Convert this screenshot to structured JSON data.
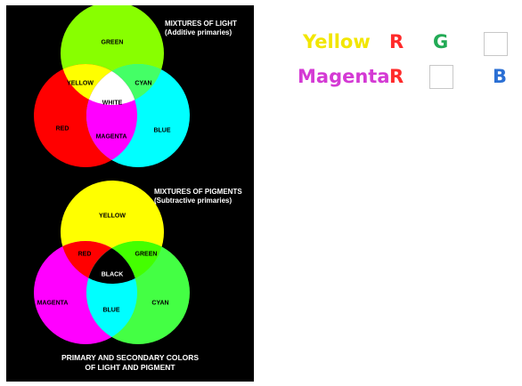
{
  "figure": {
    "light_title": "MIXTURES OF LIGHT",
    "light_subtitle": "(Additive primaries)",
    "pigment_title": "MIXTURES OF PIGMENTS",
    "pigment_subtitle": "(Subtractive primaries)",
    "caption_line1": "PRIMARY AND SECONDARY COLORS",
    "caption_line2": "OF LIGHT AND PIGMENT",
    "light_labels": {
      "green": "GREEN",
      "yellow": "YELLOW",
      "cyan": "CYAN",
      "white": "WHITE",
      "red": "RED",
      "magenta": "MAGENTA",
      "blue": "BLUE"
    },
    "pigment_labels": {
      "yellow": "YELLOW",
      "red": "RED",
      "green": "GREEN",
      "black": "BLACK",
      "magenta": "MAGENTA",
      "blue": "BLUE",
      "cyan": "CYAN"
    },
    "colors": {
      "red": "#ff0000",
      "green": "#88ff00",
      "blue": "#00ffff",
      "yellow": "#ffff00",
      "magenta": "#ff00ff",
      "cyan_pig": "#44ff44"
    }
  },
  "quiz": {
    "row1": {
      "word": "Yellow",
      "word_color": "#f2e600",
      "letter_r": "R",
      "letter_g": "G",
      "r_color": "#ff2a2a",
      "g_color": "#22aa55"
    },
    "row2": {
      "word": "Magenta",
      "word_color": "#d43ad4",
      "letter_r": "R",
      "letter_b": "B",
      "r_color": "#ff2a2a",
      "b_color": "#2a6fd4"
    }
  }
}
